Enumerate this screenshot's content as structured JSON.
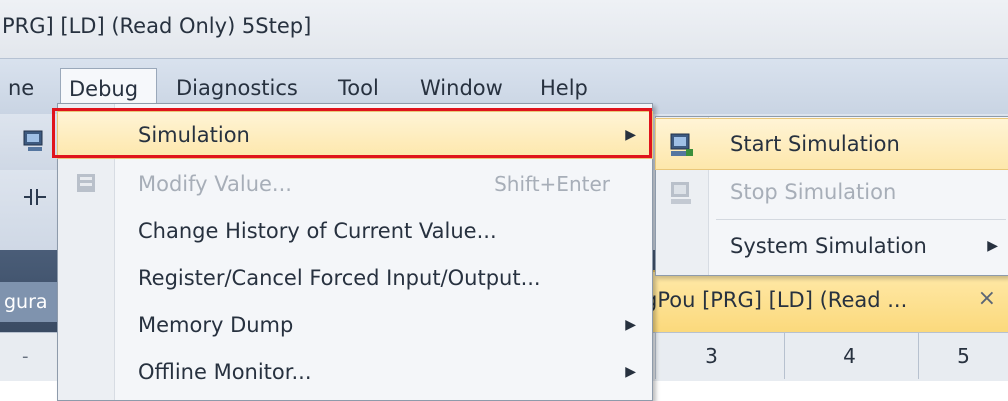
{
  "window": {
    "title": "PRG] [LD] (Read Only) 5Step]"
  },
  "menubar": {
    "items": [
      {
        "label": "ne"
      },
      {
        "label": "Debug"
      },
      {
        "label": "Diagnostics"
      },
      {
        "label": "Tool"
      },
      {
        "label": "Window"
      },
      {
        "label": "Help"
      }
    ]
  },
  "left_tab": {
    "label": "gura"
  },
  "document_tab": {
    "title": "gPou [PRG] [LD] (Read ...",
    "close": "×"
  },
  "grid": {
    "dash": "-",
    "columns": [
      "3",
      "4",
      "5"
    ]
  },
  "debug_menu": {
    "items": [
      {
        "label": "Simulation",
        "shortcut": "",
        "arrow": "▶"
      },
      {
        "label": "Modify Value...",
        "shortcut": "Shift+Enter",
        "arrow": ""
      },
      {
        "label": "Change History of Current Value...",
        "shortcut": "",
        "arrow": ""
      },
      {
        "label": "Register/Cancel Forced Input/Output...",
        "shortcut": "",
        "arrow": ""
      },
      {
        "label": "Memory Dump",
        "shortcut": "",
        "arrow": "▶"
      },
      {
        "label": "Offline Monitor...",
        "shortcut": "",
        "arrow": "▶"
      }
    ]
  },
  "simulation_submenu": {
    "items": [
      {
        "label": "Start Simulation",
        "arrow": ""
      },
      {
        "label": "Stop Simulation",
        "arrow": ""
      },
      {
        "label": "System Simulation",
        "arrow": "▶"
      }
    ]
  },
  "colors": {
    "highlight_border": "#e0141c",
    "menu_hover": "#fde7ab",
    "dark_band": "#3a4b63"
  }
}
